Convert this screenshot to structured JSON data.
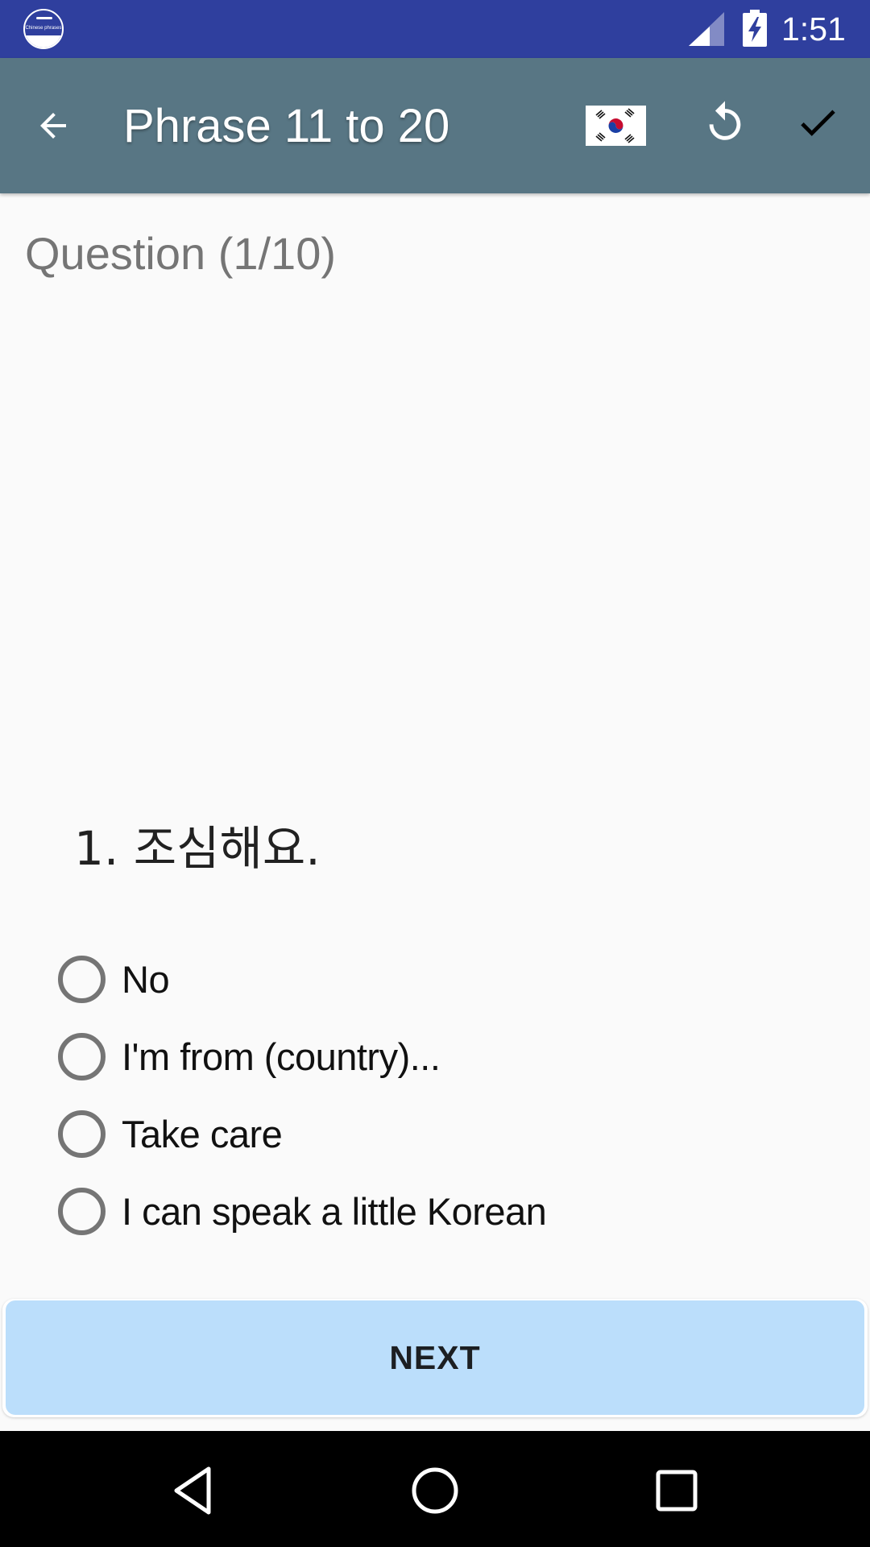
{
  "status_bar": {
    "app_icon_label": "Chinese phrases",
    "time": "1:51",
    "icons": [
      "app-notification-icon",
      "signal-icon",
      "battery-charging-icon"
    ]
  },
  "toolbar": {
    "back_icon": "arrow-back-icon",
    "title": "Phrase 11 to 20",
    "flag_icon": "south-korea-flag-icon",
    "reset_icon": "refresh-icon",
    "check_icon": "check-icon"
  },
  "quiz": {
    "counter": "Question (1/10)",
    "current_question": 1,
    "total_questions": 10,
    "question": "1. 조심해요.",
    "options": [
      {
        "label": "No",
        "selected": false
      },
      {
        "label": "I'm from (country)...",
        "selected": false
      },
      {
        "label": "Take care",
        "selected": false
      },
      {
        "label": "I can speak a little Korean",
        "selected": false
      }
    ],
    "next_label": "NEXT"
  },
  "nav_bar": {
    "icons": [
      "nav-back-icon",
      "nav-home-icon",
      "nav-recents-icon"
    ]
  },
  "colors": {
    "status_bar": "#2f3f9e",
    "toolbar": "#587684",
    "background": "#fafafa",
    "next_button": "#bbdefb",
    "radio": "#757575",
    "counter_text": "#757575"
  }
}
